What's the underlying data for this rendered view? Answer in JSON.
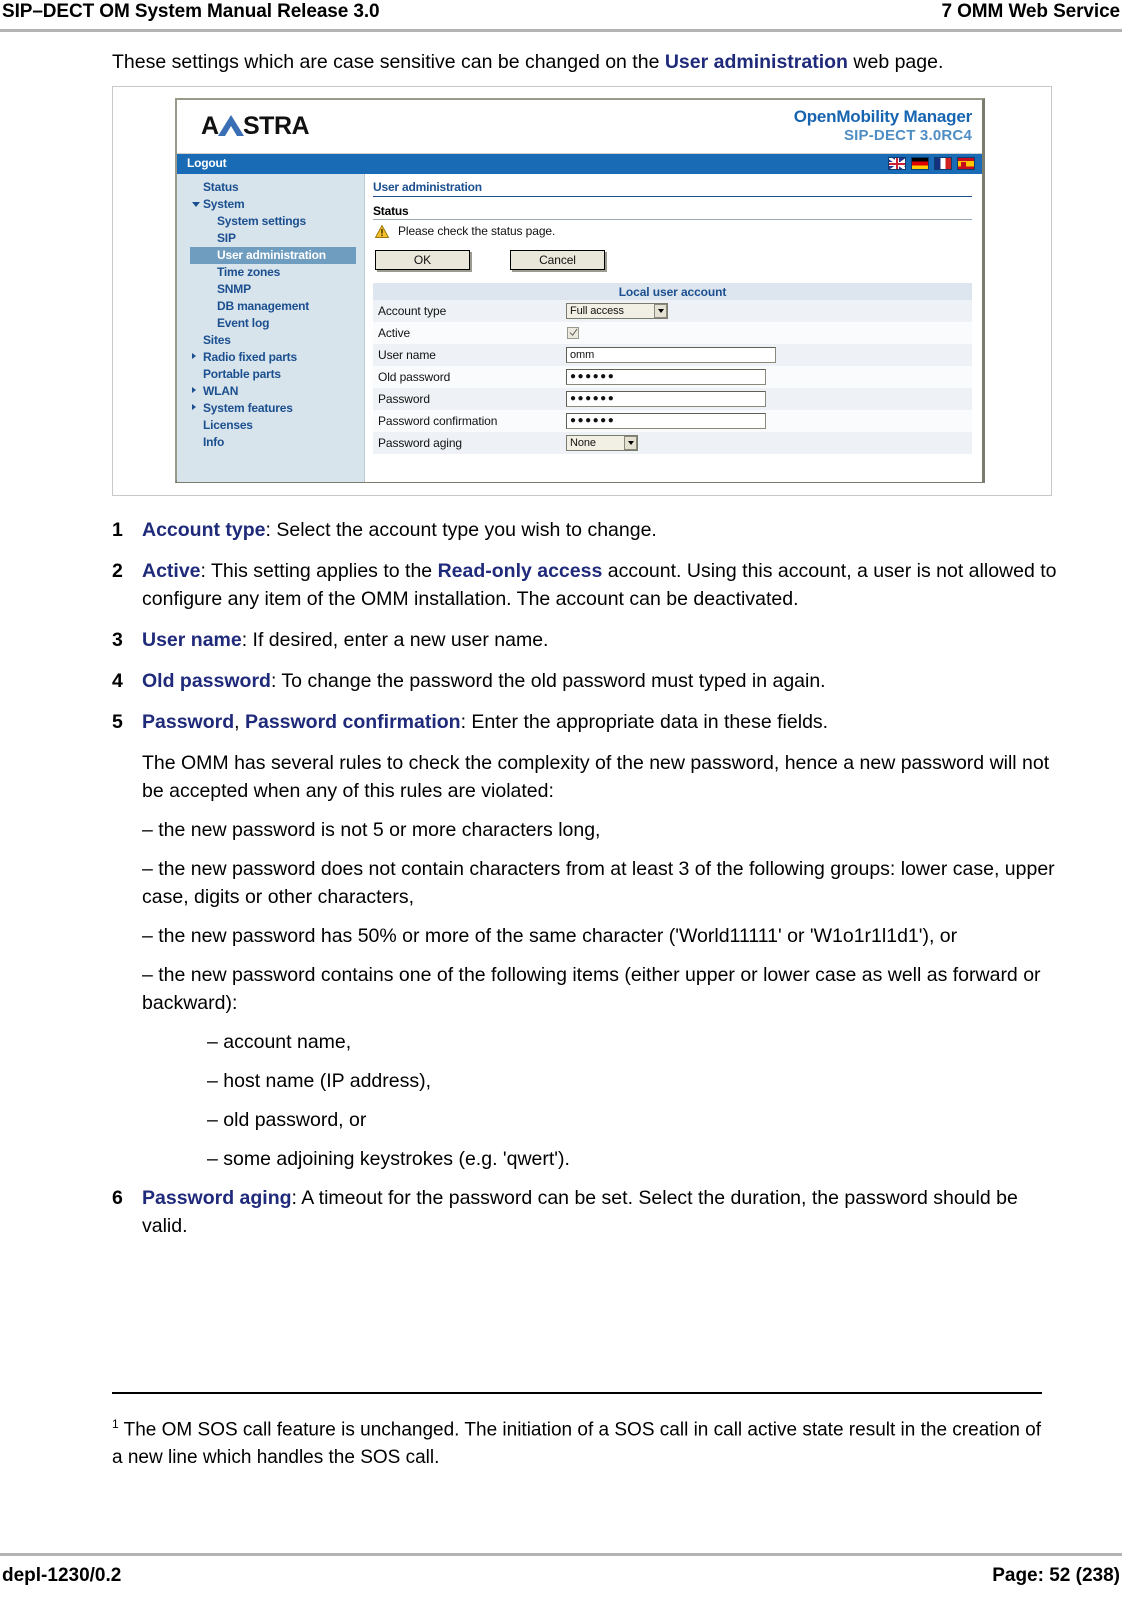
{
  "header": {
    "left": "SIP–DECT OM System Manual Release 3.0",
    "right": "7 OMM Web Service"
  },
  "intro": {
    "text_before": "These settings which are case sensitive can be changed on the ",
    "link": "User administration",
    "text_after": " web page."
  },
  "screenshot": {
    "brand": {
      "logo_text": "AASTRA",
      "product": "OpenMobility Manager",
      "version": "SIP-DECT 3.0RC4"
    },
    "topbar": {
      "logout": "Logout",
      "flags": [
        "flag-uk",
        "flag-de",
        "flag-fr",
        "flag-es"
      ]
    },
    "nav": [
      {
        "label": "Status",
        "level": 1,
        "arrow": "none",
        "selected": false
      },
      {
        "label": "System",
        "level": 1,
        "arrow": "down",
        "selected": false
      },
      {
        "label": "System settings",
        "level": 2,
        "arrow": "none",
        "selected": false
      },
      {
        "label": "SIP",
        "level": 2,
        "arrow": "none",
        "selected": false
      },
      {
        "label": "User administration",
        "level": 2,
        "arrow": "none",
        "selected": true
      },
      {
        "label": "Time zones",
        "level": 2,
        "arrow": "none",
        "selected": false
      },
      {
        "label": "SNMP",
        "level": 2,
        "arrow": "none",
        "selected": false
      },
      {
        "label": "DB management",
        "level": 2,
        "arrow": "none",
        "selected": false
      },
      {
        "label": "Event log",
        "level": 2,
        "arrow": "none",
        "selected": false
      },
      {
        "label": "Sites",
        "level": 1,
        "arrow": "none",
        "selected": false
      },
      {
        "label": "Radio fixed parts",
        "level": 1,
        "arrow": "right",
        "selected": false
      },
      {
        "label": "Portable parts",
        "level": 1,
        "arrow": "none",
        "selected": false
      },
      {
        "label": "WLAN",
        "level": 1,
        "arrow": "right",
        "selected": false
      },
      {
        "label": "System features",
        "level": 1,
        "arrow": "right",
        "selected": false
      },
      {
        "label": "Licenses",
        "level": 1,
        "arrow": "none",
        "selected": false
      },
      {
        "label": "Info",
        "level": 1,
        "arrow": "none",
        "selected": false
      }
    ],
    "main": {
      "page_title": "User administration",
      "status_title": "Status",
      "status_message": "Please check the status page.",
      "ok_button": "OK",
      "cancel_button": "Cancel",
      "table_header": "Local user account",
      "rows": [
        {
          "label": "Account type",
          "type": "select",
          "value": "Full access"
        },
        {
          "label": "Active",
          "type": "checkbox",
          "value": "checked"
        },
        {
          "label": "User name",
          "type": "text",
          "value": "omm"
        },
        {
          "label": "Old password",
          "type": "password",
          "value": "●●●●●●"
        },
        {
          "label": "Password",
          "type": "password",
          "value": "●●●●●●"
        },
        {
          "label": "Password confirmation",
          "type": "password",
          "value": "●●●●●●"
        },
        {
          "label": "Password aging",
          "type": "select",
          "value": "None"
        }
      ]
    }
  },
  "steps": [
    {
      "num": "1",
      "term": "Account type",
      "rest": ": Select the account type you wish to change."
    },
    {
      "num": "2",
      "term": "Active",
      "rest": ": This setting applies to the ",
      "term2": "Read-only access",
      "rest2": " account. Using this account, a user is not allowed to configure any item of the OMM installation. The account can be deactivated."
    },
    {
      "num": "3",
      "term": "User name",
      "rest": ": If desired, enter a new user name."
    },
    {
      "num": "4",
      "term": "Old password",
      "rest": ": To change the password the old password must typed in again."
    },
    {
      "num": "5",
      "term": "Password",
      "sep": ", ",
      "term2": "Password confirmation",
      "rest2": ": Enter the appropriate data in these fields."
    },
    {
      "num": "6",
      "term": "Password aging",
      "rest": ": A timeout for the password can be set. Select the duration, the password should be valid."
    }
  ],
  "rules": {
    "intro": "The OMM has several rules to check the complexity of the new password, hence a new password will not be accepted when any of this rules are violated:",
    "items": [
      "– the new password is not 5 or more characters long,",
      "– the new password does not contain characters from at least 3 of the following groups: lower case, upper case, digits or other characters,",
      "– the new password has 50% or more of the same character ('World11111' or 'W1o1r1l1d1'), or",
      "– the new password contains one of the following items (either upper or lower case as well as forward or backward):"
    ],
    "subitems": [
      "– account name,",
      "– host name (IP address),",
      "– old password, or",
      "– some adjoining keystrokes (e.g. 'qwert')."
    ]
  },
  "footnote": {
    "marker": "1",
    "text": " The OM SOS call feature is unchanged. The initiation of a SOS call in call active state result in the creation of a new line which handles the SOS call."
  },
  "footer": {
    "left": "depl-1230/0.2",
    "right": "Page: 52 (238)"
  }
}
